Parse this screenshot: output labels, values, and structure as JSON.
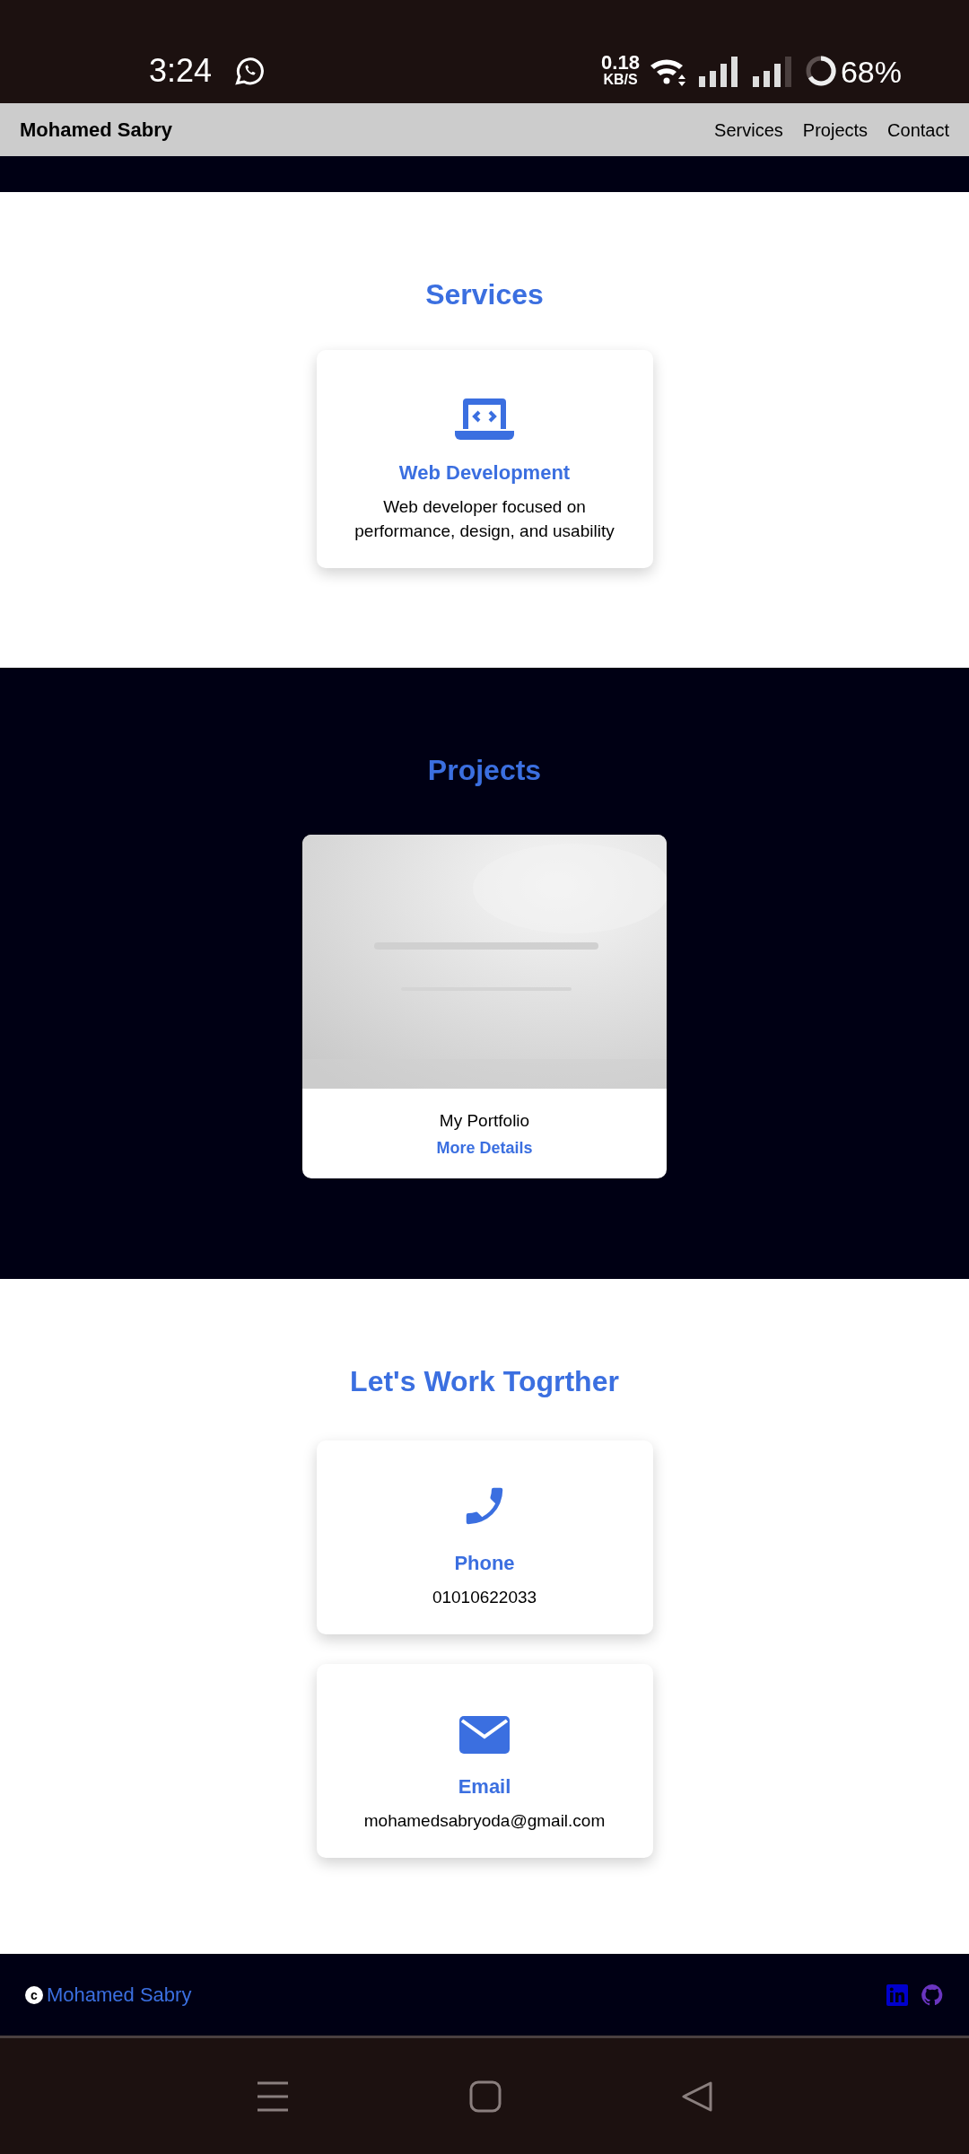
{
  "status_bar": {
    "time": "3:24",
    "net_speed": "0.18",
    "net_unit": "KB/S",
    "battery": "68%"
  },
  "navbar": {
    "brand": "Mohamed Sabry",
    "links": [
      "Services",
      "Projects",
      "Contact"
    ]
  },
  "services": {
    "title": "Services",
    "cards": [
      {
        "kind": "laptop",
        "title": "Web Development",
        "text": "Web developer focused on performance, design, and usability"
      }
    ]
  },
  "projects": {
    "title": "Projects",
    "cards": [
      {
        "title": "My Portfolio",
        "link": "More Details"
      }
    ]
  },
  "contact": {
    "title": "Let's Work Togrther",
    "cards": [
      {
        "kind": "phone",
        "title": "Phone",
        "text": "01010622033"
      },
      {
        "kind": "email",
        "title": "Email",
        "text": "mohamedsabryoda@gmail.com"
      }
    ]
  },
  "footer": {
    "copyright_symbol": "c",
    "name": "Mohamed Sabry",
    "social": [
      {
        "kind": "linkedin"
      },
      {
        "kind": "github"
      }
    ]
  }
}
